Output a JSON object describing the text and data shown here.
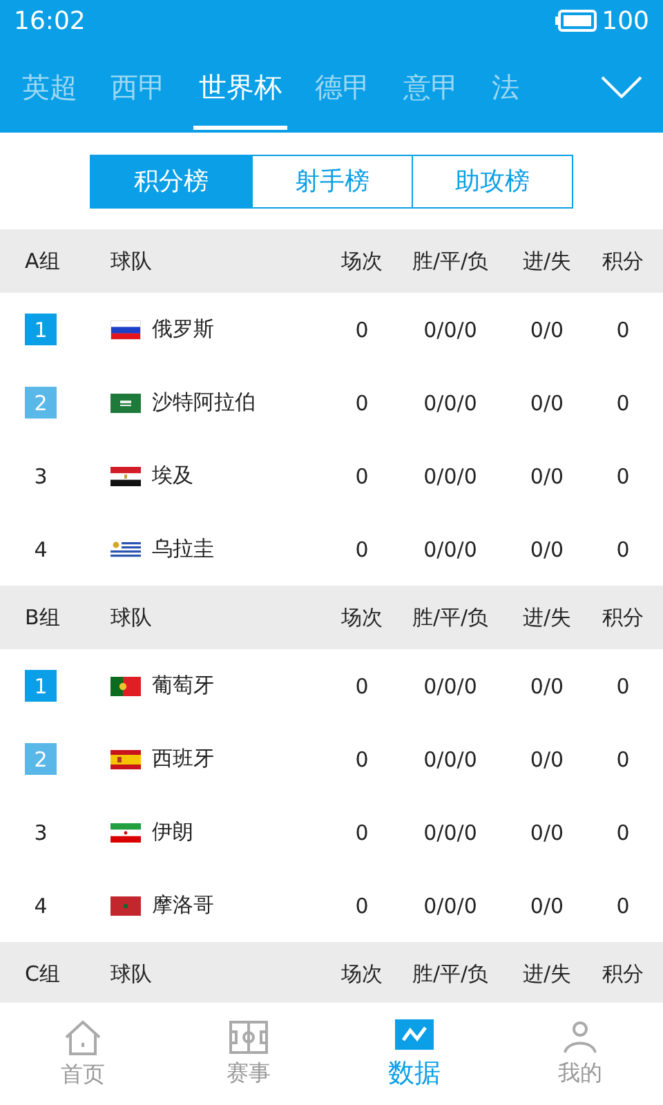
{
  "status_bar": {
    "time": "16:02",
    "battery": "100"
  },
  "league_tabs": [
    {
      "label": "英超",
      "selected": false
    },
    {
      "label": "西甲",
      "selected": false
    },
    {
      "label": "世界杯",
      "selected": true
    },
    {
      "label": "德甲",
      "selected": false
    },
    {
      "label": "意甲",
      "selected": false
    },
    {
      "label": "法",
      "selected": false
    }
  ],
  "segments": [
    {
      "label": "积分榜",
      "selected": true
    },
    {
      "label": "射手榜",
      "selected": false
    },
    {
      "label": "助攻榜",
      "selected": false
    }
  ],
  "groups": [
    {
      "name": "A组",
      "columns": [
        "球队",
        "场次",
        "胜/平/负",
        "进/失",
        "积分"
      ],
      "rows": [
        {
          "rank": "1",
          "color": "#0a9fe6",
          "team": "俄罗斯",
          "played": "0",
          "record": "0/0/0",
          "goals": "0/0",
          "points": "0"
        },
        {
          "rank": "2",
          "color": "#5ab8e8",
          "team": "沙特阿拉伯",
          "played": "0",
          "record": "0/0/0",
          "goals": "0/0",
          "points": "0"
        },
        {
          "rank": "3",
          "team": "埃及",
          "played": "0",
          "record": "0/0/0",
          "goals": "0/0",
          "points": "0"
        },
        {
          "rank": "4",
          "team": "乌拉圭",
          "played": "0",
          "record": "0/0/0",
          "goals": "0/0",
          "points": "0"
        }
      ]
    },
    {
      "name": "B组",
      "columns": [
        "球队",
        "场次",
        "胜/平/负",
        "进/失",
        "积分"
      ],
      "rows": [
        {
          "rank": "1",
          "color": "#0a9fe6",
          "team": "葡萄牙",
          "played": "0",
          "record": "0/0/0",
          "goals": "0/0",
          "points": "0"
        },
        {
          "rank": "2",
          "color": "#5ab8e8",
          "team": "西班牙",
          "played": "0",
          "record": "0/0/0",
          "goals": "0/0",
          "points": "0"
        },
        {
          "rank": "3",
          "team": "伊朗",
          "played": "0",
          "record": "0/0/0",
          "goals": "0/0",
          "points": "0"
        },
        {
          "rank": "4",
          "team": "摩洛哥",
          "played": "0",
          "record": "0/0/0",
          "goals": "0/0",
          "points": "0"
        }
      ]
    },
    {
      "name": "C组",
      "columns": [
        "球队",
        "场次",
        "胜/平/负",
        "进/失",
        "积分"
      ]
    }
  ],
  "bottom_nav": [
    {
      "label": "首页",
      "kind": "home",
      "selected": false
    },
    {
      "label": "赛事",
      "kind": "matches",
      "selected": false
    },
    {
      "label": "数据",
      "kind": "data",
      "selected": true
    },
    {
      "label": "我的",
      "kind": "profile",
      "selected": false
    }
  ]
}
